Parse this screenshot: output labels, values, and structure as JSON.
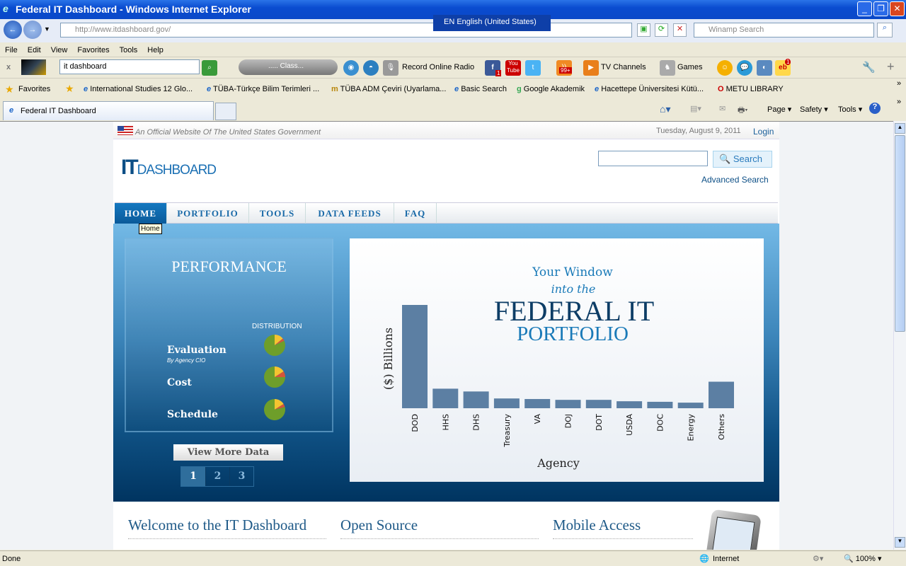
{
  "window": {
    "title": "Federal IT Dashboard - Windows Internet Explorer"
  },
  "address": {
    "url": "http://www.itdashboard.gov/",
    "search_placeholder": "Winamp Search"
  },
  "language_bar": {
    "label": "EN English (United States)"
  },
  "menu": [
    "File",
    "Edit",
    "View",
    "Favorites",
    "Tools",
    "Help"
  ],
  "toolbar": {
    "search_value": "it dashboard",
    "player_label": "..... Class...",
    "radio_label": "Record Online Radio",
    "tv_label": "TV Channels",
    "games_label": "Games",
    "facebook_badge": "1",
    "rss_badge": "99+",
    "mail_badge": "1"
  },
  "favorites": {
    "label": "Favorites",
    "items": [
      "International Studies 12 Glo...",
      "TÜBA-Türkçe Bilim Terimleri ...",
      "TÜBA ADM Çeviri (Uyarlama...",
      "Basic Search",
      "Google Akademik",
      "Hacettepe Üniversitesi Kütü...",
      "METU LIBRARY"
    ]
  },
  "tabs": [
    {
      "label": "Federal IT Dashboard"
    }
  ],
  "command_bar": [
    "Page",
    "Safety",
    "Tools"
  ],
  "site": {
    "official_notice": "An Official Website Of The United States Government",
    "date": "Tuesday, August 9, 2011",
    "login": "Login",
    "logo": {
      "it": "IT",
      "dashboard": "DASHBOARD"
    },
    "search_button": "Search",
    "advanced_search": "Advanced Search",
    "nav": [
      "HOME",
      "PORTFOLIO",
      "TOOLS",
      "DATA FEEDS",
      "FAQ"
    ],
    "tooltip": "Home",
    "performance": {
      "title": "PERFORMANCE",
      "distribution_label": "DISTRIBUTION",
      "rows": [
        {
          "label": "Evaluation",
          "sub": "By Agency CIO",
          "green": 82,
          "yellow": 14,
          "red": 4
        },
        {
          "label": "Cost",
          "green": 75,
          "yellow": 16,
          "red": 9
        },
        {
          "label": "Schedule",
          "green": 79,
          "yellow": 16,
          "red": 5
        }
      ],
      "colors": {
        "green": "#6e9e2a",
        "yellow": "#f4c430",
        "red": "#d4553a"
      },
      "view_more": "View More Data",
      "pages": [
        "1",
        "2",
        "3"
      ]
    },
    "hero_title": {
      "line1": "Your Window",
      "line2": "into the",
      "line3": "FEDERAL IT",
      "line4": "PORTFOLIO"
    },
    "sections": [
      "Welcome to the IT Dashboard",
      "Open Source",
      "Mobile Access"
    ]
  },
  "chart_data": {
    "type": "bar",
    "categories": [
      "DOD",
      "HHS",
      "DHS",
      "Treasury",
      "VA",
      "DOJ",
      "DOT",
      "USDA",
      "DOC",
      "Energy",
      "Others"
    ],
    "values": [
      37,
      7,
      6,
      3.5,
      3.3,
      3,
      3,
      2.5,
      2.3,
      2,
      9.5
    ],
    "xlabel": "Agency",
    "ylabel": "($) Billions",
    "bar_color": "#5c7fa3",
    "grid": false
  },
  "status": {
    "text": "Done",
    "zone": "Internet",
    "zoom": "100%"
  }
}
